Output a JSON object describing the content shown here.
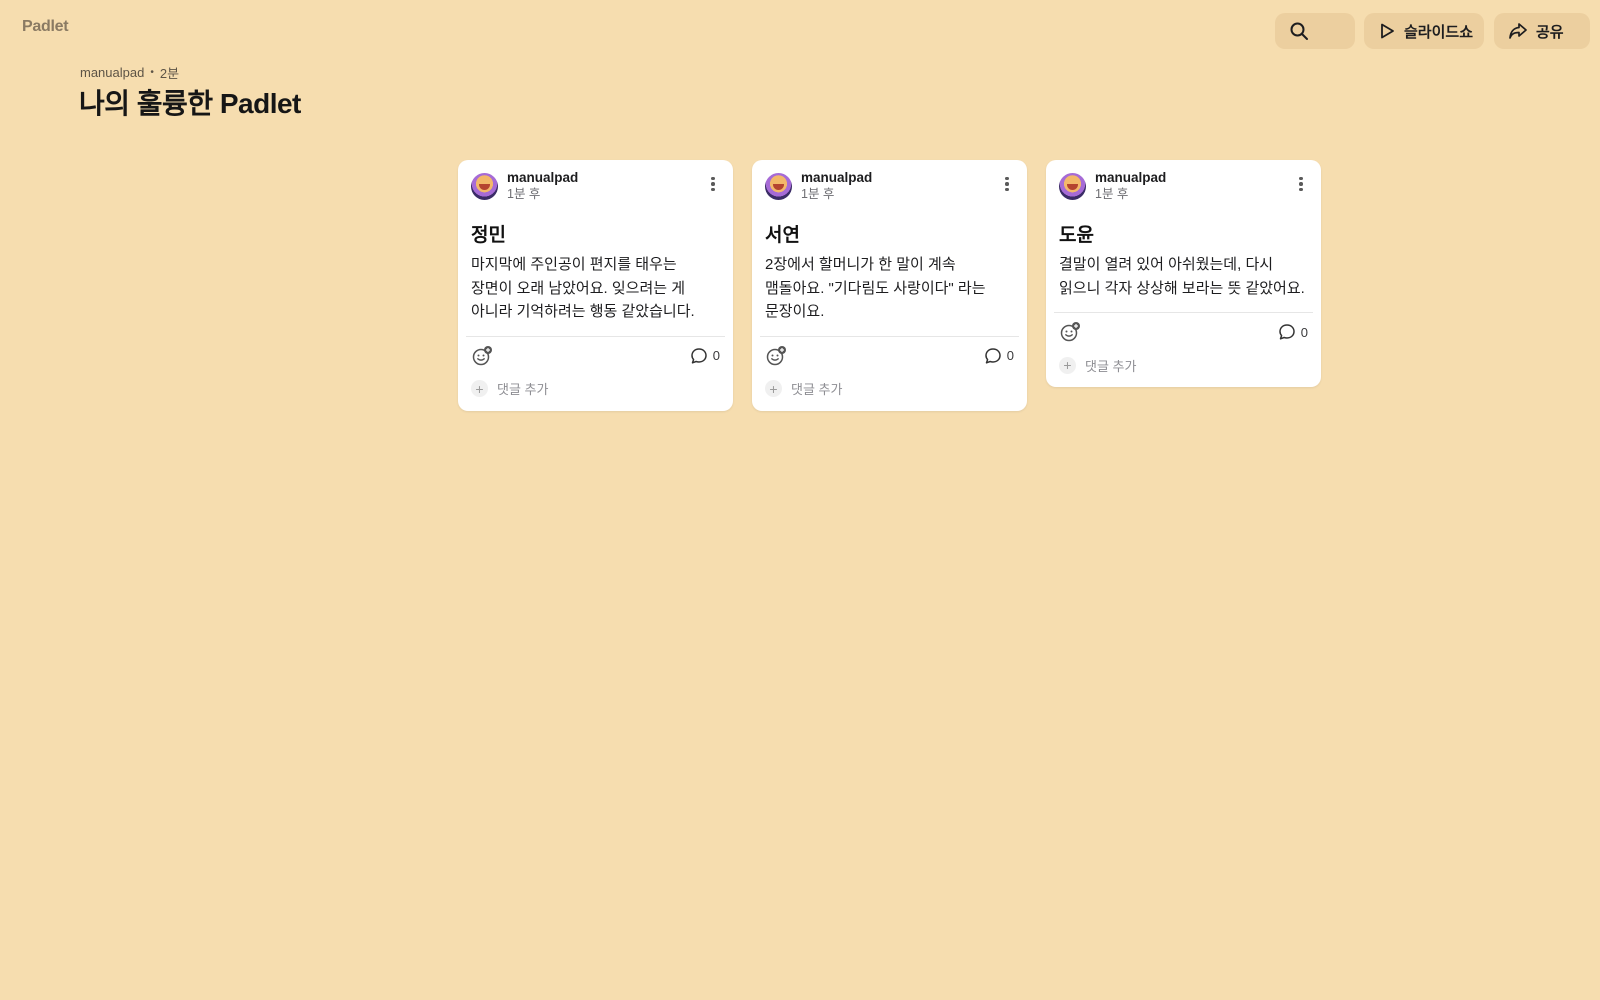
{
  "app": {
    "logo": "Padlet"
  },
  "toolbar": {
    "search_icon": "search-icon",
    "slideshow_label": "슬라이드쇼",
    "share_label": "공유"
  },
  "board": {
    "author": "manualpad",
    "age": "2분",
    "title": "나의 훌륭한 Padlet"
  },
  "posts": [
    {
      "author": "manualpad",
      "time": "1분 후",
      "title": "정민",
      "body": "마지막에 주인공이 편지를 태우는 장면이 오래 남았어요. 잊으려는 게 아니라 기억하려는 행동 같았습니다.",
      "comment_count": "0",
      "add_comment": "댓글 추가"
    },
    {
      "author": "manualpad",
      "time": "1분 후",
      "title": "서연",
      "body": "2장에서 할머니가 한 말이 계속 맴돌아요. \"기다림도 사랑이다\" 라는 문장이요.",
      "comment_count": "0",
      "add_comment": "댓글 추가"
    },
    {
      "author": "manualpad",
      "time": "1분 후",
      "title": "도윤",
      "body": "결말이 열려 있어 아쉬웠는데, 다시 읽으니 각자 상상해 보라는 뜻 같았어요.",
      "comment_count": "0",
      "add_comment": "댓글 추가"
    }
  ],
  "colors": {
    "background": "#f6ddaf",
    "toolbar_button": "#eccf9f",
    "card": "#ffffff"
  }
}
